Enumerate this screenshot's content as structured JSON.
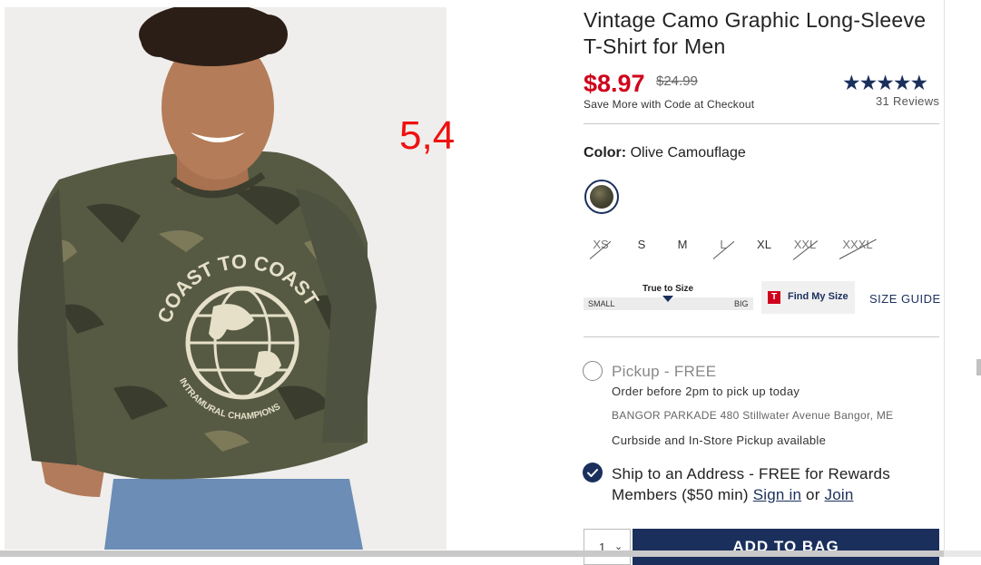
{
  "overlay": {
    "annotation": "5,4"
  },
  "product": {
    "title": "Vintage Camo Graphic Long-Sleeve T-Shirt for Men",
    "price": "$8.97",
    "original_price": "$24.99",
    "promo": "Save More with Code at Checkout",
    "rating_stars": "★★★★★",
    "reviews": "31 Reviews",
    "shirt_print": {
      "top": "COAST TO COAST",
      "bottom": "INTRAMURAL CHAMPIONS"
    }
  },
  "color": {
    "label": "Color:",
    "value": "Olive Camouflage",
    "swatch_color": "#4a4a36"
  },
  "sizes": [
    {
      "label": "XS",
      "available": false
    },
    {
      "label": "S",
      "available": true
    },
    {
      "label": "M",
      "available": true
    },
    {
      "label": "L",
      "available": false
    },
    {
      "label": "XL",
      "available": true
    },
    {
      "label": "XXL",
      "available": false
    },
    {
      "label": "XXXL",
      "available": false
    }
  ],
  "fit": {
    "title": "True to Size",
    "low": "SMALL",
    "high": "BIG"
  },
  "find_my_size": {
    "icon_letter": "T",
    "label": "Find My Size"
  },
  "size_guide": "SIZE GUIDE",
  "pickup": {
    "title": "Pickup - FREE",
    "order_before": "Order before 2pm to pick up today",
    "store": "BANGOR PARKADE 480 Stillwater Avenue  Bangor, ME",
    "availability": "Curbside and In-Store Pickup available"
  },
  "ship": {
    "text": "Ship to an Address - FREE for Rewards Members ($50 min)",
    "sign_in": "Sign in",
    "or": "or",
    "join": "Join"
  },
  "cart": {
    "quantity": "1",
    "add_label": "ADD TO BAG"
  },
  "colors": {
    "brand_navy": "#1b2f5c",
    "sale_red": "#d0021b"
  }
}
